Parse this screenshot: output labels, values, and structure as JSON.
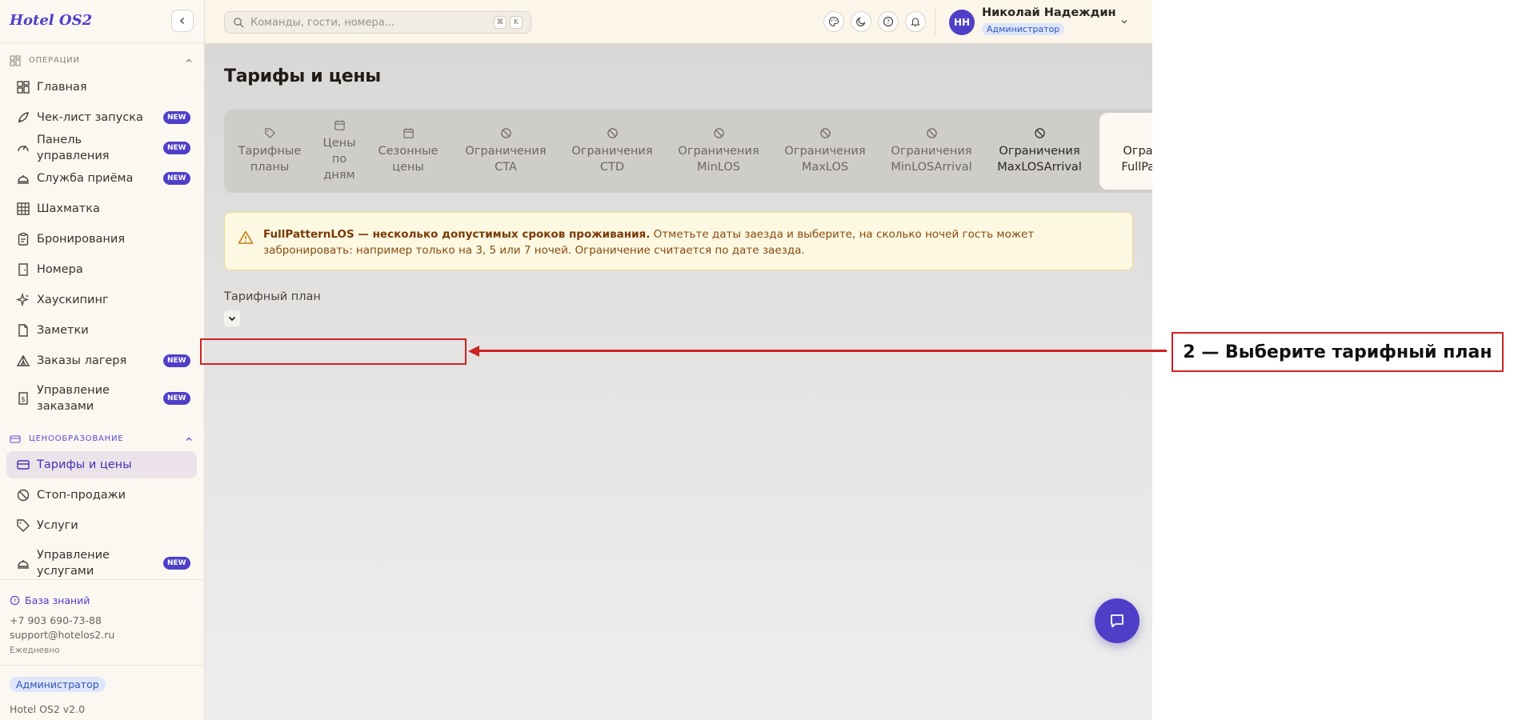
{
  "app": {
    "logo": "Hotel OS2"
  },
  "sidebar": {
    "sections": {
      "operations": "Операции",
      "pricing": "Ценообразование"
    },
    "badge_new": "NEW",
    "items": [
      {
        "label": "Главная",
        "icon": "dashboard-icon"
      },
      {
        "label": "Чек-лист запуска",
        "icon": "rocket-icon",
        "badge": "NEW"
      },
      {
        "label": "Панель управления",
        "icon": "gauge-icon",
        "badge": "NEW"
      },
      {
        "label": "Служба приёма",
        "icon": "bell-desk-icon",
        "badge": "NEW"
      },
      {
        "label": "Шахматка",
        "icon": "grid-icon"
      },
      {
        "label": "Бронирования",
        "icon": "clipboard-icon"
      },
      {
        "label": "Номера",
        "icon": "door-icon"
      },
      {
        "label": "Хаускипинг",
        "icon": "sparkles-icon"
      },
      {
        "label": "Заметки",
        "icon": "note-icon"
      },
      {
        "label": "Заказы лагеря",
        "icon": "tent-icon",
        "badge": "NEW"
      },
      {
        "label": "Управление заказами",
        "icon": "receipt-icon",
        "badge": "NEW"
      },
      {
        "label": "Тарифы и цены",
        "icon": "card-icon",
        "active": true
      },
      {
        "label": "Стоп-продажи",
        "icon": "ban-icon"
      },
      {
        "label": "Услуги",
        "icon": "tag-icon"
      },
      {
        "label": "Управление услугами",
        "icon": "bell-desk-icon",
        "badge": "NEW"
      }
    ],
    "footer": {
      "kb_label": "База знаний",
      "phone": "+7 903 690-73-88",
      "email": "support@hotelos2.ru",
      "hours": "Ежедневно",
      "role": "Администратор",
      "version": "Hotel OS2 v2.0"
    }
  },
  "topbar": {
    "search_placeholder": "Команды, гости, номера...",
    "kbd": [
      "⌘",
      "K"
    ],
    "user_initials": "НН",
    "user_name": "Николай Надеждин",
    "user_role": "Администратор"
  },
  "main": {
    "title": "Тарифы и цены",
    "tabs": [
      {
        "label": "Тарифные планы",
        "icon": "tag-icon"
      },
      {
        "label": "Цены по дням",
        "icon": "calendar-icon"
      },
      {
        "label": "Сезонные цены",
        "icon": "calendar-icon"
      },
      {
        "label": "Ограничения CTA",
        "icon": "ban-icon"
      },
      {
        "label": "Ограничения CTD",
        "icon": "ban-icon"
      },
      {
        "label": "Ограничения MinLOS",
        "icon": "ban-icon"
      },
      {
        "label": "Ограничения MaxLOS",
        "icon": "ban-icon"
      },
      {
        "label": "Ограничения MinLOSArrival",
        "icon": "ban-icon"
      },
      {
        "label": "Ограничения MaxLOSArrival",
        "icon": "ban-icon"
      },
      {
        "label": "Ограничения FullPatternLOS",
        "icon": "ban-icon",
        "active": true
      }
    ],
    "alert": {
      "title": "FullPatternLOS — несколько допустимых сроков проживания.",
      "text": " Отметьте даты заезда и выберите, на сколько ночей гость может забронировать: например только на 3, 5 или 7 ночей. Ограничение считается по дате заезда."
    },
    "rate_plan_label": "Тарифный план",
    "rate_plan_value": ""
  },
  "annotation": {
    "label": "2 — Выберите тарифный план"
  }
}
